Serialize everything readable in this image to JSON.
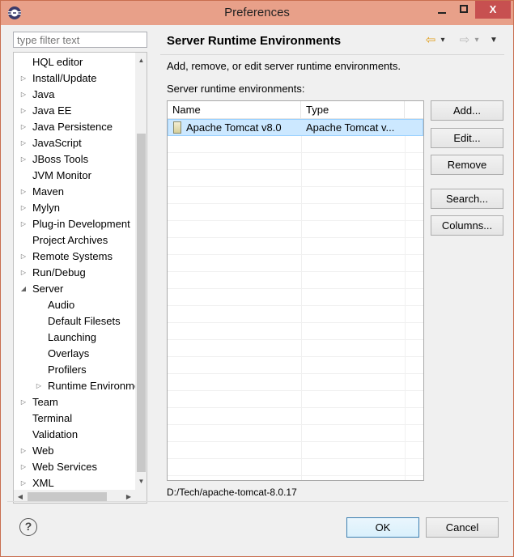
{
  "window": {
    "title": "Preferences",
    "minimize": "–",
    "maximize": "□",
    "close": "X"
  },
  "filter": {
    "placeholder": "type filter text"
  },
  "tree": {
    "items": [
      {
        "label": "HQL editor",
        "arrow": ""
      },
      {
        "label": "Install/Update",
        "arrow": "▷"
      },
      {
        "label": "Java",
        "arrow": "▷"
      },
      {
        "label": "Java EE",
        "arrow": "▷"
      },
      {
        "label": "Java Persistence",
        "arrow": "▷"
      },
      {
        "label": "JavaScript",
        "arrow": "▷"
      },
      {
        "label": "JBoss Tools",
        "arrow": "▷"
      },
      {
        "label": "JVM Monitor",
        "arrow": ""
      },
      {
        "label": "Maven",
        "arrow": "▷"
      },
      {
        "label": "Mylyn",
        "arrow": "▷"
      },
      {
        "label": "Plug-in Development",
        "arrow": "▷"
      },
      {
        "label": "Project Archives",
        "arrow": ""
      },
      {
        "label": "Remote Systems",
        "arrow": "▷"
      },
      {
        "label": "Run/Debug",
        "arrow": "▷"
      },
      {
        "label": "Server",
        "arrow": "◢"
      },
      {
        "label": "Audio",
        "arrow": ""
      },
      {
        "label": "Default Filesets",
        "arrow": ""
      },
      {
        "label": "Launching",
        "arrow": ""
      },
      {
        "label": "Overlays",
        "arrow": ""
      },
      {
        "label": "Profilers",
        "arrow": ""
      },
      {
        "label": "Runtime Environments",
        "arrow": "▷"
      },
      {
        "label": "Team",
        "arrow": "▷"
      },
      {
        "label": "Terminal",
        "arrow": ""
      },
      {
        "label": "Validation",
        "arrow": ""
      },
      {
        "label": "Web",
        "arrow": "▷"
      },
      {
        "label": "Web Services",
        "arrow": "▷"
      },
      {
        "label": "XML",
        "arrow": "▷"
      }
    ]
  },
  "page": {
    "title": "Server Runtime Environments",
    "description": "Add, remove, or edit server runtime environments.",
    "list_label": "Server runtime environments:",
    "columns": [
      "Name",
      "Type"
    ],
    "rows": [
      {
        "name": "Apache Tomcat v8.0",
        "type": "Apache Tomcat v..."
      }
    ],
    "path": "D:/Tech/apache-tomcat-8.0.17"
  },
  "buttons": {
    "add": "Add...",
    "edit": "Edit...",
    "remove": "Remove",
    "search": "Search...",
    "columns": "Columns...",
    "ok": "OK",
    "cancel": "Cancel",
    "help": "?"
  },
  "nav": {
    "back": "⇦",
    "back_menu": "▾",
    "forward": "⇨",
    "forward_menu": "▾",
    "view_menu": "▼"
  },
  "colors": {
    "title_bar": "#e8a089",
    "close_button": "#c75050",
    "selection": "#cce8ff",
    "back_arrow": "#e0a020"
  }
}
